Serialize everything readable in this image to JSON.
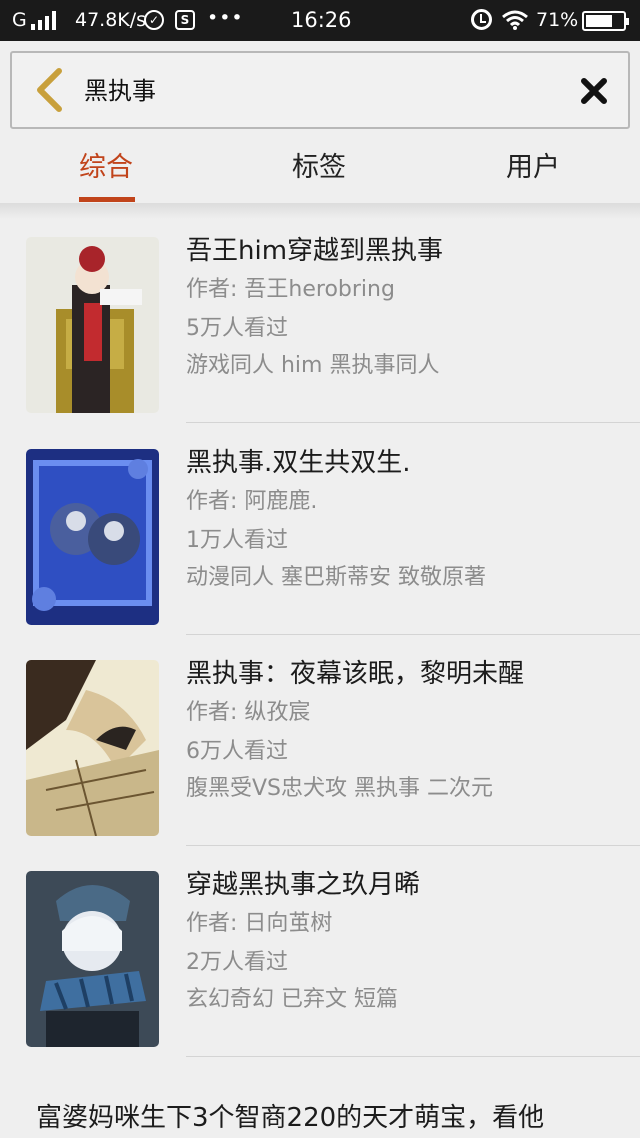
{
  "status_bar": {
    "network": "G",
    "speed": "47.8K/s",
    "more": "•••",
    "time": "16:26",
    "battery": "71%",
    "battery_level": 0.71,
    "icons": [
      "signal-icon",
      "shield-icon",
      "sim-icon",
      "alarm-icon",
      "wifi-icon",
      "battery-icon"
    ]
  },
  "search": {
    "query": "黑执事",
    "back_icon": "chevron-left-icon",
    "clear_icon": "close-icon",
    "accent": "#c8a03c"
  },
  "tabs": [
    {
      "label": "综合",
      "active": true
    },
    {
      "label": "标签",
      "active": false
    },
    {
      "label": "用户",
      "active": false
    }
  ],
  "colors": {
    "accent": "#c1441b",
    "meta_text": "#8c8c8c"
  },
  "results": [
    {
      "title": "吾王him穿越到黑执事",
      "author": "作者: 吾王herobring",
      "views": "5万人看过",
      "tags": "游戏同人  him  黑执事同人"
    },
    {
      "title": "黑执事.双生共双生.",
      "author": "作者: 阿鹿鹿.",
      "views": "1万人看过",
      "tags": "动漫同人  塞巴斯蒂安  致敬原著"
    },
    {
      "title": "黑执事：夜幕该眠，黎明未醒",
      "author": "作者: 纵孜宸",
      "views": "6万人看过",
      "tags": "腹黑受VS忠犬攻  黑执事  二次元"
    },
    {
      "title": "穿越黑执事之玖月晞",
      "author": "作者: 日向茧树",
      "views": "2万人看过",
      "tags": "玄幻奇幻  已弃文  短篇"
    }
  ],
  "summary_text": "富婆妈咪生下3个智商220的天才萌宝，看他"
}
